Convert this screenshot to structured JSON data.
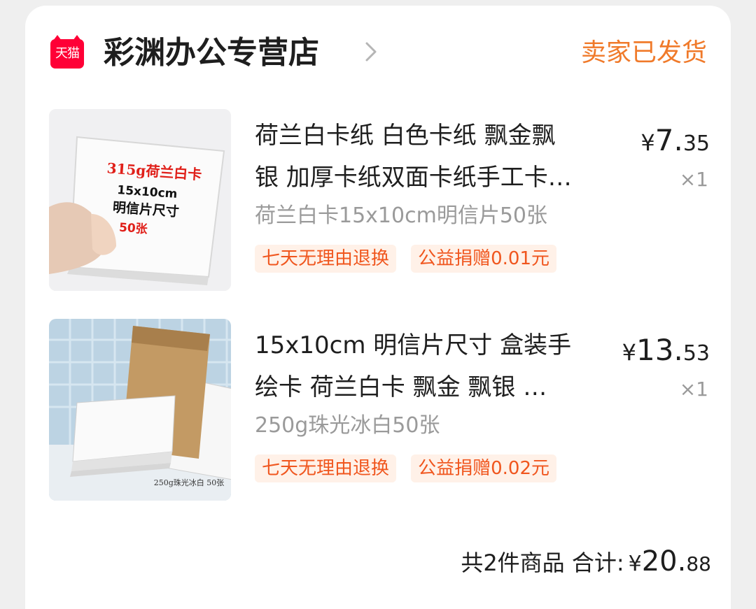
{
  "shop": {
    "badge": "天猫",
    "name": "彩渊办公专营店",
    "status": "卖家已发货",
    "status_color": "#f07a2a"
  },
  "items": [
    {
      "title_line1": "荷兰白卡纸 白色卡纸 飘金飘",
      "title_line2": "银 加厚卡纸双面卡纸手工卡…",
      "sku": "荷兰白卡15x10cm明信片50张",
      "tags": [
        "七天无理由退换",
        "公益捐赠0.01元"
      ],
      "price_symbol": "¥",
      "price_int": "7.",
      "price_dec": "35",
      "qty": "×1",
      "image_text": [
        "315g荷兰白卡",
        "15x10cm",
        "明信片尺寸",
        "50张"
      ]
    },
    {
      "title_line1": "15x10cm 明信片尺寸 盒装手",
      "title_line2": "绘卡 荷兰白卡 飘金 飘银 …",
      "sku": "250g珠光冰白50张",
      "tags": [
        "七天无理由退换",
        "公益捐赠0.02元"
      ],
      "price_symbol": "¥",
      "price_int": "13.",
      "price_dec": "53",
      "qty": "×1",
      "image_text": [
        "250g珠光冰白 50张"
      ]
    }
  ],
  "summary": {
    "label": "共2件商品 合计:",
    "symbol": "¥",
    "total_int": "20.",
    "total_dec": "88"
  },
  "colors": {
    "tag_bg": "#fff1e8",
    "tag_text": "#f0561e",
    "tmall_red": "#ff0036"
  }
}
